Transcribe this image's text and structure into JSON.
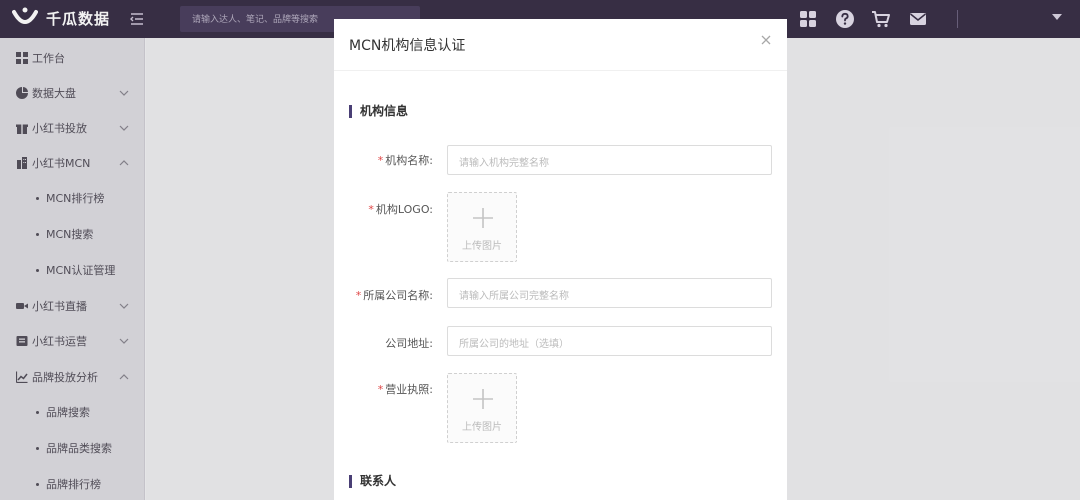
{
  "app": {
    "logo_text": "千瓜数据",
    "search_placeholder": "请输入达人、笔记、品牌等搜索"
  },
  "header_icons": [
    "apps-icon",
    "help-icon",
    "cart-icon",
    "mail-icon",
    "dropdown-caret-icon"
  ],
  "sidebar": {
    "items": [
      {
        "label": "工作台",
        "icon": "dashboard-icon",
        "sub": false,
        "chevron": "none"
      },
      {
        "label": "数据大盘",
        "icon": "pie-chart-icon",
        "sub": false,
        "chevron": "down"
      },
      {
        "label": "小红书投放",
        "icon": "gift-icon",
        "sub": false,
        "chevron": "down"
      },
      {
        "label": "小红书MCN",
        "icon": "building-icon",
        "sub": false,
        "chevron": "up"
      },
      {
        "label": "MCN排行榜",
        "icon": "",
        "sub": true,
        "chevron": "none"
      },
      {
        "label": "MCN搜索",
        "icon": "",
        "sub": true,
        "chevron": "none"
      },
      {
        "label": "MCN认证管理",
        "icon": "",
        "sub": true,
        "chevron": "none"
      },
      {
        "label": "小红书直播",
        "icon": "video-icon",
        "sub": false,
        "chevron": "down"
      },
      {
        "label": "小红书运营",
        "icon": "bookmark-icon",
        "sub": false,
        "chevron": "down"
      },
      {
        "label": "品牌投放分析",
        "icon": "analytics-icon",
        "sub": false,
        "chevron": "up"
      },
      {
        "label": "品牌搜索",
        "icon": "",
        "sub": true,
        "chevron": "none"
      },
      {
        "label": "品牌品类搜索",
        "icon": "",
        "sub": true,
        "chevron": "none"
      },
      {
        "label": "品牌排行榜",
        "icon": "",
        "sub": true,
        "chevron": "none"
      }
    ]
  },
  "modal": {
    "title": "MCN机构信息认证",
    "close_icon": "close-icon",
    "section_org": "机构信息",
    "section_contact": "联系人",
    "fields": {
      "org_name": {
        "label": "机构名称:",
        "required": "*",
        "placeholder": "请输入机构完整名称"
      },
      "org_logo": {
        "label": "机构LOGO:",
        "required": "*",
        "upload_text": "上传图片"
      },
      "company_name": {
        "label": "所属公司名称:",
        "required": "*",
        "placeholder": "请输入所属公司完整名称"
      },
      "company_address": {
        "label": "公司地址:",
        "placeholder": "所属公司的地址（选填）"
      },
      "business_license": {
        "label": "营业执照:",
        "required": "*",
        "upload_text": "上传图片"
      }
    }
  },
  "colors": {
    "topbar": "#3a3148",
    "accent": "#4a3f75",
    "required": "#e04545"
  }
}
